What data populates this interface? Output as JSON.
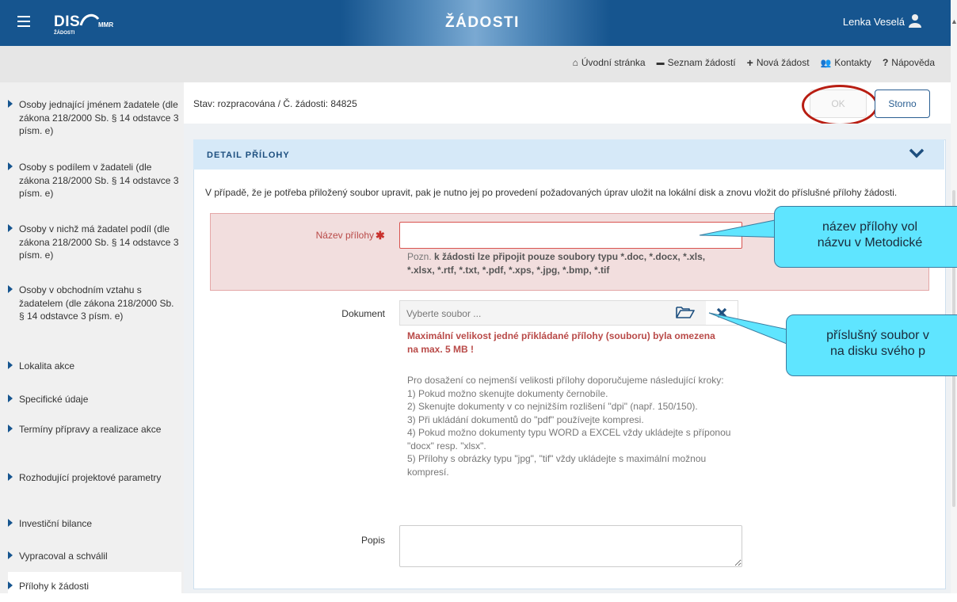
{
  "header": {
    "logo": "DIS",
    "logo_sub": "ŽÁDOSTI",
    "logo_brand": "MMR",
    "title": "ŽÁDOSTI",
    "user_name": "Lenka Veselá"
  },
  "nav": {
    "items": [
      {
        "icon": "home-icon",
        "label": "Úvodní stránka"
      },
      {
        "icon": "list-icon",
        "label": "Seznam žádostí"
      },
      {
        "icon": "plus-icon",
        "label": "Nová žádost"
      },
      {
        "icon": "users-icon",
        "label": "Kontakty"
      },
      {
        "icon": "question-icon",
        "label": "Nápověda"
      }
    ],
    "glyphs": {
      "home": "⌂",
      "list": "▬",
      "plus": "+",
      "users": "👥",
      "question": "?"
    }
  },
  "sidebar": {
    "items": [
      {
        "label": "Osoby jednající jménem žadatele (dle zákona 218/2000 Sb. § 14 odstavce 3 písm. e)"
      },
      {
        "label": "Osoby s podílem v žadateli (dle zákona 218/2000 Sb. § 14 odstavce 3 písm. e)"
      },
      {
        "label": "Osoby v nichž má žadatel podíl (dle zákona 218/2000 Sb. § 14 odstavce 3 písm. e)"
      },
      {
        "label": "Osoby v obchodním vztahu s žadatelem (dle zákona 218/2000 Sb. § 14 odstavce 3 písm. e)"
      },
      {
        "label": "Lokalita akce"
      },
      {
        "label": "Specifické údaje"
      },
      {
        "label": "Termíny přípravy a realizace akce"
      },
      {
        "label": "Rozhodující projektové parametry"
      },
      {
        "label": "Investiční bilance"
      },
      {
        "label": "Vypracoval a schválil"
      },
      {
        "label": "Přílohy k žádosti"
      }
    ]
  },
  "status": {
    "text": "Stav: rozpracována  /  Č. žádosti: 84825",
    "ok_label": "OK",
    "storno_label": "Storno"
  },
  "panel": {
    "title": "DETAIL PŘÍLOHY",
    "info": "V případě, že je potřeba přiložený soubor upravit, pak je nutno jej po provedení požadovaných úprav uložit na lokální disk a znovu vložit do příslušné přílohy žádosti.",
    "name_label": "Název přílohy",
    "required_mark": "✱",
    "name_value": "",
    "note_prefix": "Pozn.",
    "note_bold": "k žádosti lze připojit pouze soubory typu *.doc, *.docx, *.xls, *.xlsx, *.rtf, *.txt, *.pdf, *.xps, *.jpg, *.bmp, *.tif",
    "doc_label": "Dokument",
    "file_placeholder": "Vyberte soubor ...",
    "max_warning": "Maximální velikost jedné přikládané přílohy (souboru) byla omezena na max. 5 MB !",
    "tips": [
      "Pro dosažení co nejmenší velikosti přílohy doporučujeme následující kroky:",
      "1) Pokud možno skenujte dokumenty černobíle.",
      "2) Skenujte dokumenty v co nejnižším rozlišení \"dpi\" (např. 150/150).",
      "3) Při ukládání dokumentů do \"pdf\" používejte kompresi.",
      "4) Pokud možno dokumenty typu WORD a EXCEL vždy ukládejte s příponou \"docx\" resp. \"xlsx\".",
      "5) Přílohy s obrázky typu \"jpg\", \"tif\" vždy ukládejte s maximální možnou kompresí."
    ],
    "popis_label": "Popis",
    "popis_value": ""
  },
  "callouts": {
    "c1_line1": "název přílohy vol",
    "c1_line2": "názvu v Metodické",
    "c2_line1": "příslušný soubor v",
    "c2_line2": "na disku svého p"
  },
  "colors": {
    "header_blue": "#16558f",
    "accent_red": "#b94a48",
    "callout_cyan": "#5fe5ff"
  }
}
